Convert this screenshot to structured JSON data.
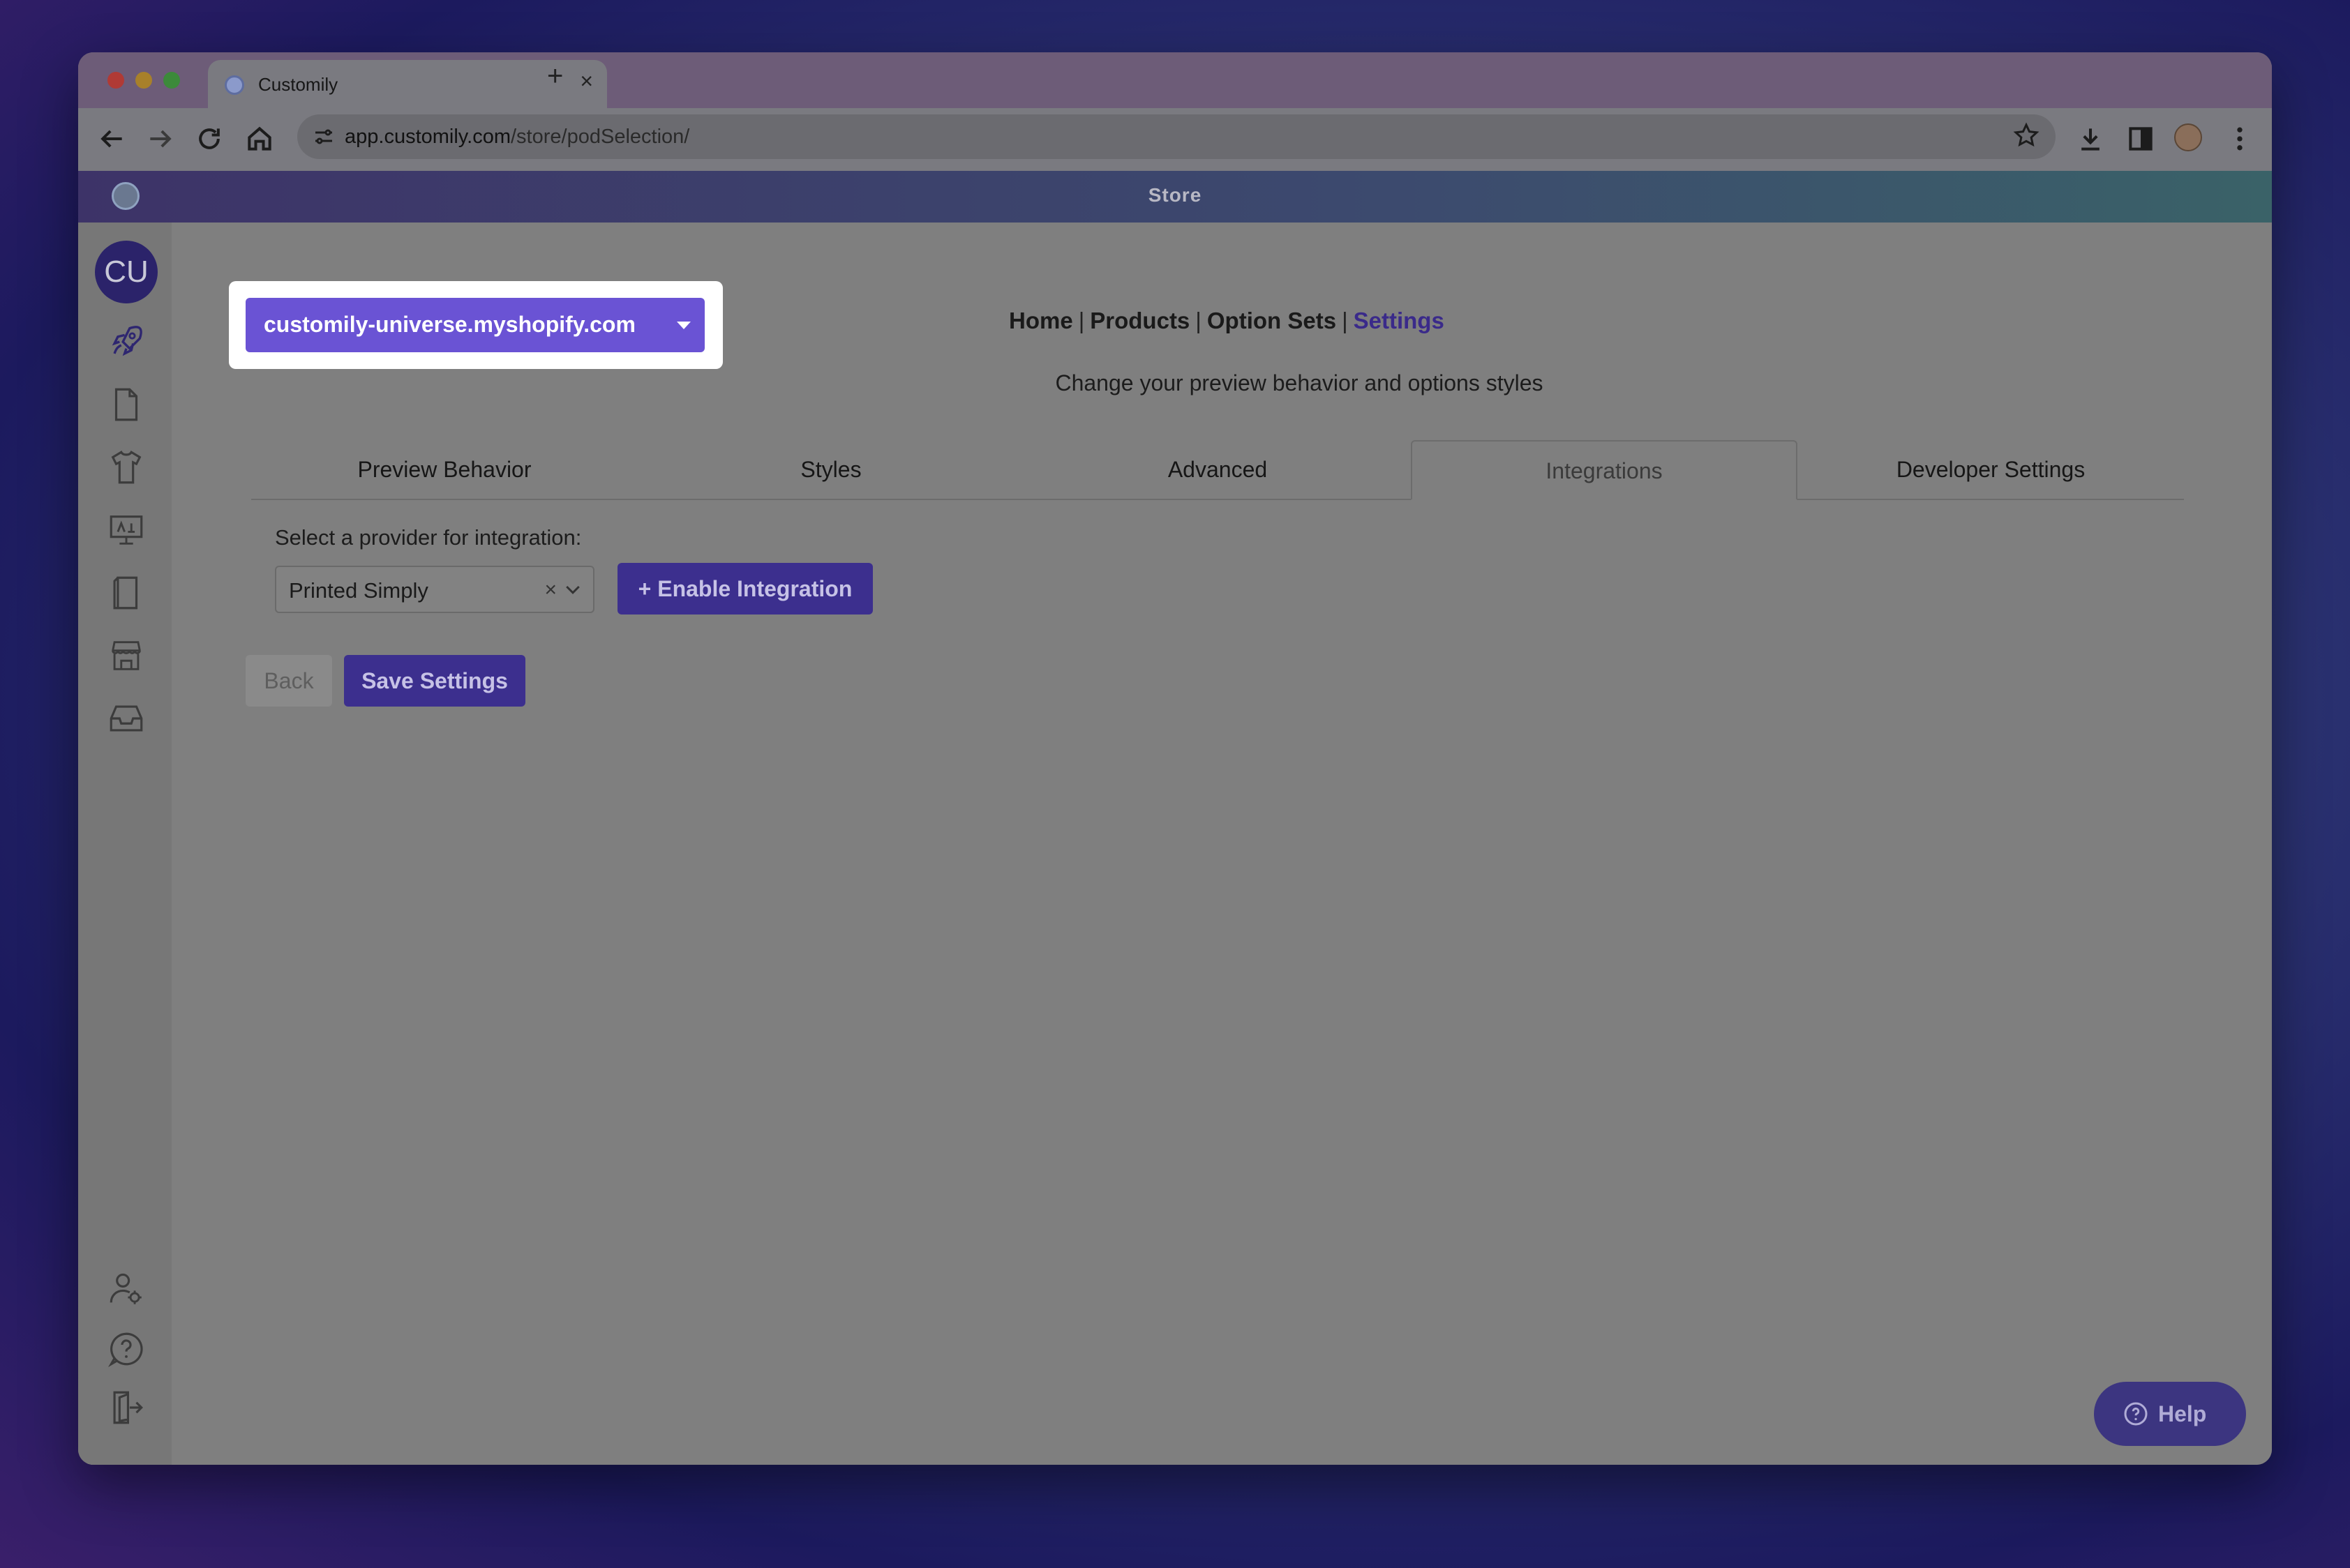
{
  "browser": {
    "tab_title": "Customily",
    "url_host": "app.customily.com",
    "url_path": "/store/podSelection/"
  },
  "app": {
    "header_title": "Store",
    "avatar_initials": "CU",
    "store_selector": "customily-universe.myshopify.com",
    "nav": {
      "home": "Home",
      "products": "Products",
      "option_sets": "Option Sets",
      "settings": "Settings",
      "separator": "|"
    },
    "subtitle": "Change your preview behavior and options styles",
    "tabs": [
      {
        "label": "Preview Behavior"
      },
      {
        "label": "Styles"
      },
      {
        "label": "Advanced"
      },
      {
        "label": "Integrations"
      },
      {
        "label": "Developer Settings"
      }
    ],
    "active_tab": "Integrations",
    "integration": {
      "label": "Select a provider for integration:",
      "selected_provider": "Printed Simply",
      "clear_glyph": "×",
      "enable_button": "+ Enable Integration"
    },
    "buttons": {
      "back": "Back",
      "save": "Save Settings"
    },
    "help_label": "Help",
    "colors": {
      "accent": "#6a53d4",
      "button_primary": "#3c2f8e",
      "active_nav": "#3a2a8a"
    }
  }
}
